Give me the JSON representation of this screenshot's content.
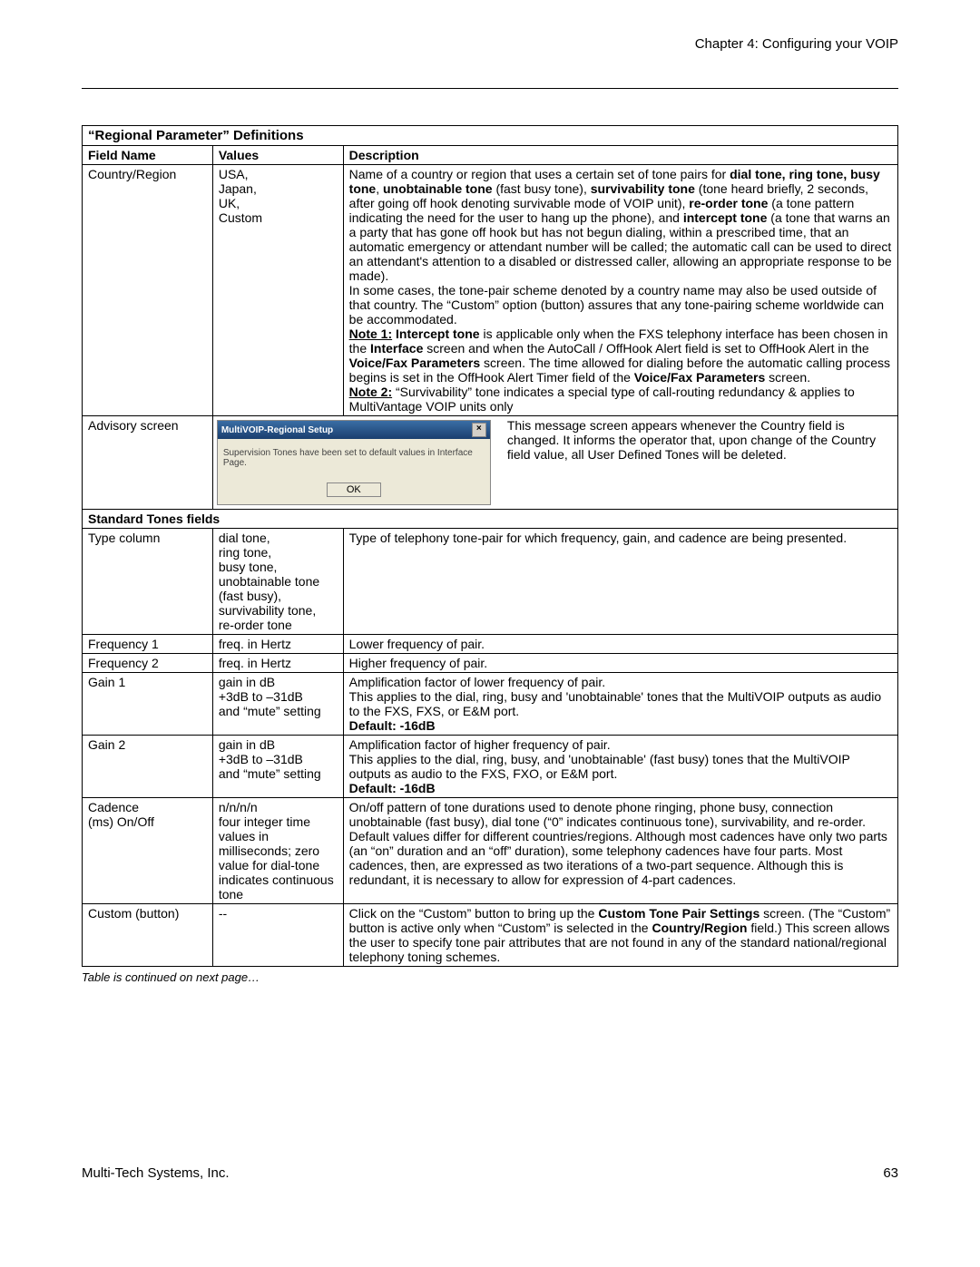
{
  "header": "Chapter 4: Configuring your VOIP",
  "table_title": "“Regional Parameter” Definitions",
  "col_headers": [
    "Field Name",
    "Values",
    "Description"
  ],
  "row_country": {
    "field": "Country/Region",
    "values": [
      "USA,",
      "Japan,",
      "UK,",
      "Custom"
    ]
  },
  "desc_country_pre": "Name of a country or region that uses a certain set of tone pairs for ",
  "b_dial": "dial tone, ring tone, busy tone",
  "comma1": ", ",
  "b_unobtain": "unobtainable tone",
  "txt_fastbusy": " (fast busy tone), ",
  "b_surv": "survivability tone",
  "txt_after_surv": " (tone heard briefly, 2 seconds, after going off hook denoting survivable mode of VOIP unit), ",
  "b_reorder": "re-order tone",
  "txt_after_reorder": " (a tone pattern indicating the need for the user to hang up the phone), and ",
  "b_intercept": "intercept tone",
  "txt_after_intercept": " (a tone that warns an a party that has gone off hook but has not begun dialing, within a prescribed time, that an automatic emergency or attendant number will be called; the automatic call can be used to direct an attendant's attention to a disabled or distressed caller, allowing an appropriate response to be made).",
  "txt_insome": "In some cases, the tone-pair scheme denoted by a country name may also be used outside of that country.  The “Custom” option (button) assures that any tone-pairing scheme worldwide can be accommodated.",
  "note1_label": "Note 1:",
  "note1_b1": " Intercept tone",
  "note1_mid1": " is applicable only when the FXS telephony interface has been chosen in the ",
  "note1_b2": "Interface",
  "note1_mid2": " screen and when the AutoCall / OffHook Alert field is set to OffHook Alert in the ",
  "note1_b3": "Voice/Fax Parameters",
  "note1_mid3": " screen.  The time allowed for dialing before the automatic calling process begins is set in the OffHook Alert Timer field of the ",
  "note1_b4": "Voice/Fax Parameters",
  "note1_end": " screen.",
  "note2_label": "Note 2:",
  "note2_txt": "  “Survivability” tone indicates a special type of call-routing redundancy  & applies to MultiVantage VOIP units only",
  "row_advisory": {
    "field": "Advisory screen",
    "dlg_title": "MultiVOIP-Regional Setup",
    "dlg_text": "Supervision Tones have been set to default values in Interface Page.",
    "dlg_ok": "OK",
    "desc": "This message screen appears whenever the Country field is changed. It informs the operator that, upon change of the Country field value, all User Defined Tones will be deleted."
  },
  "section_standard": "Standard Tones fields",
  "row_type": {
    "field": "Type column",
    "values": [
      "dial tone,",
      "ring tone,",
      "busy tone,",
      "unobtainable tone (fast busy),",
      "survivability tone,",
      "re-order tone"
    ],
    "desc": "Type of telephony tone-pair for which frequency, gain, and cadence are being presented."
  },
  "row_freq1": {
    "field": "Frequency 1",
    "values": "freq. in Hertz",
    "desc": "Lower frequency of pair."
  },
  "row_freq2": {
    "field": "Frequency 2",
    "values": "freq. in Hertz",
    "desc": "Higher frequency of pair."
  },
  "row_gain1": {
    "field": "Gain 1",
    "values": [
      "gain in dB",
      "+3dB to –31dB",
      "and  “mute” setting"
    ],
    "desc1": "Amplification factor of  lower frequency of pair.",
    "desc2": "This applies to the dial, ring, busy and 'unobtainable' tones that the MultiVOIP outputs as audio to the FXS, FXS, or E&M port.",
    "default": "Default:   -16dB"
  },
  "row_gain2": {
    "field": "Gain 2",
    "values": [
      "gain in dB",
      "+3dB to –31dB",
      "and  “mute” setting"
    ],
    "desc1": "Amplification factor of higher frequency of pair.",
    "desc2": "This applies to the dial, ring, busy, and 'unobtainable' (fast busy) tones that the MultiVOIP outputs as audio to the FXS, FXO, or E&M port.",
    "default": "Default:  -16dB"
  },
  "row_cadence": {
    "field": [
      "Cadence",
      "(ms) On/Off"
    ],
    "values": [
      "n/n/n/n",
      "four integer time values in milliseconds; zero value for dial-tone indicates continuous tone"
    ],
    "desc": "On/off pattern of tone durations used to denote phone ringing, phone busy, connection unobtainable (fast busy), dial tone (“0” indicates continuous tone), survivability, and re-order.  Default values differ for different countries/regions.  Although most cadences have only two parts (an  “on” duration and an “off” duration),  some telephony cadences have four parts.  Most cadences, then, are expressed as two iterations of a two-part sequence.  Although this is redundant, it is necessary to allow for expression of 4-part cadences."
  },
  "row_custom": {
    "field": "Custom (button)",
    "values": "--",
    "pre": "Click on the “Custom” button to bring up the ",
    "b1": "Custom Tone Pair Settings",
    "mid": " screen. (The “Custom” button is active only when “Custom” is selected in the ",
    "b2": "Country/Region",
    "end": " field.)  This screen allows the user to specify tone pair attributes that are not found in any of the standard national/regional telephony toning schemes."
  },
  "footnote": "Table is continued on next page…",
  "footer_left": "Multi-Tech Systems, Inc.",
  "footer_right": "63"
}
